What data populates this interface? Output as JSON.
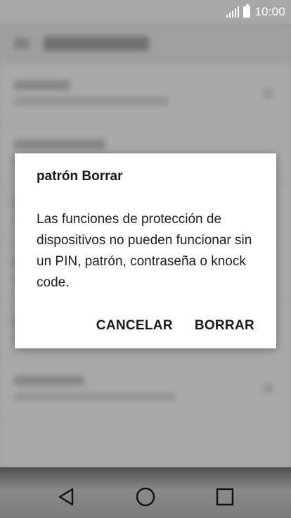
{
  "status_bar": {
    "time": "10:00",
    "icons": [
      "signal-icon",
      "battery-icon"
    ]
  },
  "dialog": {
    "title": "patrón Borrar",
    "message": "Las funciones de protección de dispositivos no pueden funcionar sin un PIN, patrón, contraseña o knock code.",
    "cancel_label": "CANCELAR",
    "confirm_label": "BORRAR"
  },
  "nav_bar": {
    "icons": [
      "back-icon",
      "home-icon",
      "recent-apps-icon"
    ]
  },
  "colors": {
    "dialog_background": "#ffffff",
    "scrim": "#9c9c9c",
    "text": "#1a1a1a"
  }
}
